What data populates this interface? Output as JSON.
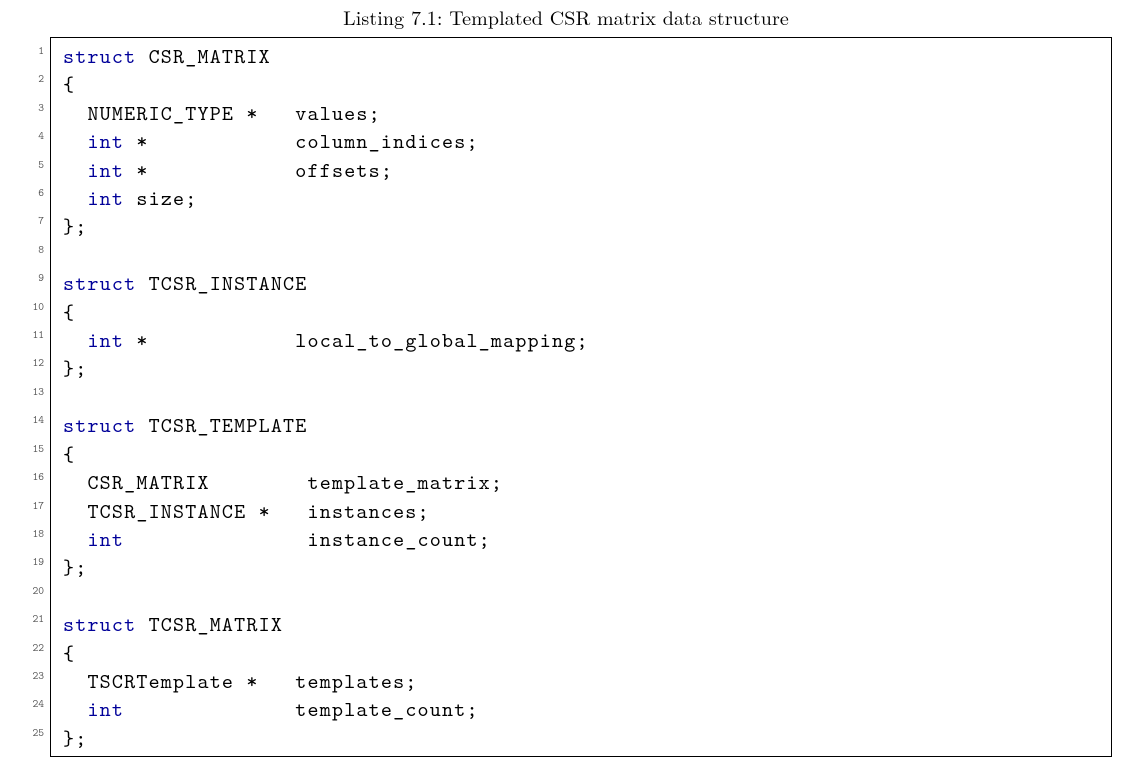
{
  "caption": "Listing 7.1: Templated CSR matrix data structure",
  "lines": [
    {
      "n": 1,
      "segs": [
        {
          "t": "struct",
          "kw": true
        },
        {
          "t": " CSR_MATRIX"
        }
      ]
    },
    {
      "n": 2,
      "segs": [
        {
          "t": "{"
        }
      ]
    },
    {
      "n": 3,
      "segs": [
        {
          "t": "  NUMERIC_TYPE *   values;"
        }
      ]
    },
    {
      "n": 4,
      "segs": [
        {
          "t": "  "
        },
        {
          "t": "int",
          "kw": true
        },
        {
          "t": " *            column_indices;"
        }
      ]
    },
    {
      "n": 5,
      "segs": [
        {
          "t": "  "
        },
        {
          "t": "int",
          "kw": true
        },
        {
          "t": " *            offsets;"
        }
      ]
    },
    {
      "n": 6,
      "segs": [
        {
          "t": "  "
        },
        {
          "t": "int",
          "kw": true
        },
        {
          "t": " size;"
        }
      ]
    },
    {
      "n": 7,
      "segs": [
        {
          "t": "};"
        }
      ]
    },
    {
      "n": 8,
      "segs": [
        {
          "t": ""
        }
      ]
    },
    {
      "n": 9,
      "segs": [
        {
          "t": "struct",
          "kw": true
        },
        {
          "t": " TCSR_INSTANCE"
        }
      ]
    },
    {
      "n": 10,
      "segs": [
        {
          "t": "{"
        }
      ]
    },
    {
      "n": 11,
      "segs": [
        {
          "t": "  "
        },
        {
          "t": "int",
          "kw": true
        },
        {
          "t": " *            local_to_global_mapping;"
        }
      ]
    },
    {
      "n": 12,
      "segs": [
        {
          "t": "};"
        }
      ]
    },
    {
      "n": 13,
      "segs": [
        {
          "t": ""
        }
      ]
    },
    {
      "n": 14,
      "segs": [
        {
          "t": "struct",
          "kw": true
        },
        {
          "t": " TCSR_TEMPLATE"
        }
      ]
    },
    {
      "n": 15,
      "segs": [
        {
          "t": "{"
        }
      ]
    },
    {
      "n": 16,
      "segs": [
        {
          "t": "  CSR_MATRIX        template_matrix;"
        }
      ]
    },
    {
      "n": 17,
      "segs": [
        {
          "t": "  TCSR_INSTANCE *   instances;"
        }
      ]
    },
    {
      "n": 18,
      "segs": [
        {
          "t": "  "
        },
        {
          "t": "int",
          "kw": true
        },
        {
          "t": "               instance_count;"
        }
      ]
    },
    {
      "n": 19,
      "segs": [
        {
          "t": "};"
        }
      ]
    },
    {
      "n": 20,
      "segs": [
        {
          "t": ""
        }
      ]
    },
    {
      "n": 21,
      "segs": [
        {
          "t": "struct",
          "kw": true
        },
        {
          "t": " TCSR_MATRIX"
        }
      ]
    },
    {
      "n": 22,
      "segs": [
        {
          "t": "{"
        }
      ]
    },
    {
      "n": 23,
      "segs": [
        {
          "t": "  TSCRTemplate *   templates;"
        }
      ]
    },
    {
      "n": 24,
      "segs": [
        {
          "t": "  "
        },
        {
          "t": "int",
          "kw": true
        },
        {
          "t": "              template_count;"
        }
      ]
    },
    {
      "n": 25,
      "segs": [
        {
          "t": "};"
        }
      ]
    }
  ]
}
